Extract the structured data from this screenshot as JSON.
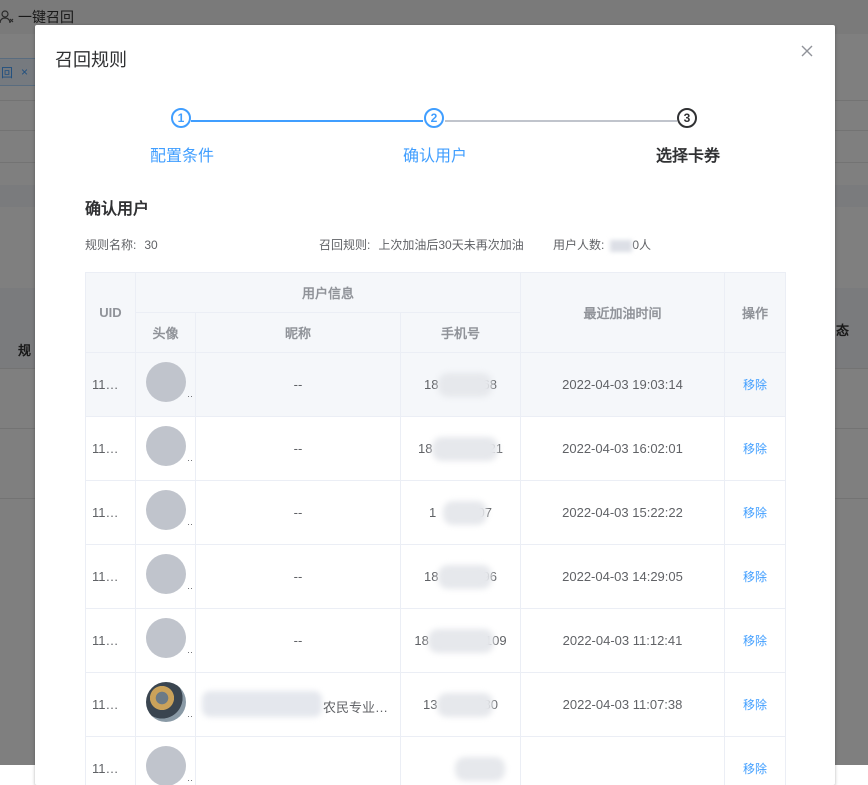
{
  "background": {
    "recall_all": "一键召回",
    "tag_label": "回",
    "tag_close": "×",
    "th_left": "规",
    "th_right": "态"
  },
  "dialog": {
    "title": "召回规则",
    "close_icon": "close-icon"
  },
  "steps": [
    {
      "number": "1",
      "label": "配置条件",
      "state": "done"
    },
    {
      "number": "2",
      "label": "确认用户",
      "state": "done"
    },
    {
      "number": "3",
      "label": "选择卡券",
      "state": "active"
    }
  ],
  "section_title": "确认用户",
  "info": {
    "rule_name_key": "规则名称:",
    "rule_name_val": "30",
    "recall_rule_key": "召回规则:",
    "recall_rule_val": "上次加油后30天未再次加油",
    "user_count_key": "用户人数:",
    "user_count_suffix": "0人"
  },
  "table": {
    "headers": {
      "uid": "UID",
      "user_info": "用户信息",
      "avatar": "头像",
      "nickname": "昵称",
      "phone": "手机号",
      "last_refuel": "最近加油时间",
      "action": "操作"
    },
    "rows": [
      {
        "uid": "11…",
        "nickname": "--",
        "phone_prefix": "18",
        "phone_suffix": "68",
        "time": "2022-04-03 19:03:14",
        "action": "移除",
        "avatar": "default"
      },
      {
        "uid": "11…",
        "nickname": "--",
        "phone_prefix": "18",
        "phone_suffix": "21",
        "time": "2022-04-03 16:02:01",
        "action": "移除",
        "avatar": "default"
      },
      {
        "uid": "11…",
        "nickname": "--",
        "phone_prefix": "1",
        "phone_suffix": "007",
        "time": "2022-04-03 15:22:22",
        "action": "移除",
        "avatar": "default"
      },
      {
        "uid": "11…",
        "nickname": "--",
        "phone_prefix": "18",
        "phone_suffix": "96",
        "time": "2022-04-03 14:29:05",
        "action": "移除",
        "avatar": "default"
      },
      {
        "uid": "11…",
        "nickname": "--",
        "phone_prefix": "18",
        "phone_suffix": "109",
        "time": "2022-04-03 11:12:41",
        "action": "移除",
        "avatar": "default"
      },
      {
        "uid": "11…",
        "nickname": "农民专业…",
        "phone_prefix": "13",
        "phone_suffix": "80",
        "time": "2022-04-03 11:07:38",
        "action": "移除",
        "avatar": "photo"
      },
      {
        "uid": "11…",
        "nickname": "",
        "phone_prefix": "",
        "phone_suffix": "",
        "time": "",
        "action": "移除",
        "avatar": "default"
      }
    ]
  },
  "colors": {
    "primary": "#409eff",
    "active_step": "#303133",
    "header_bg": "#f5f7fa",
    "border": "#ebeef5"
  }
}
